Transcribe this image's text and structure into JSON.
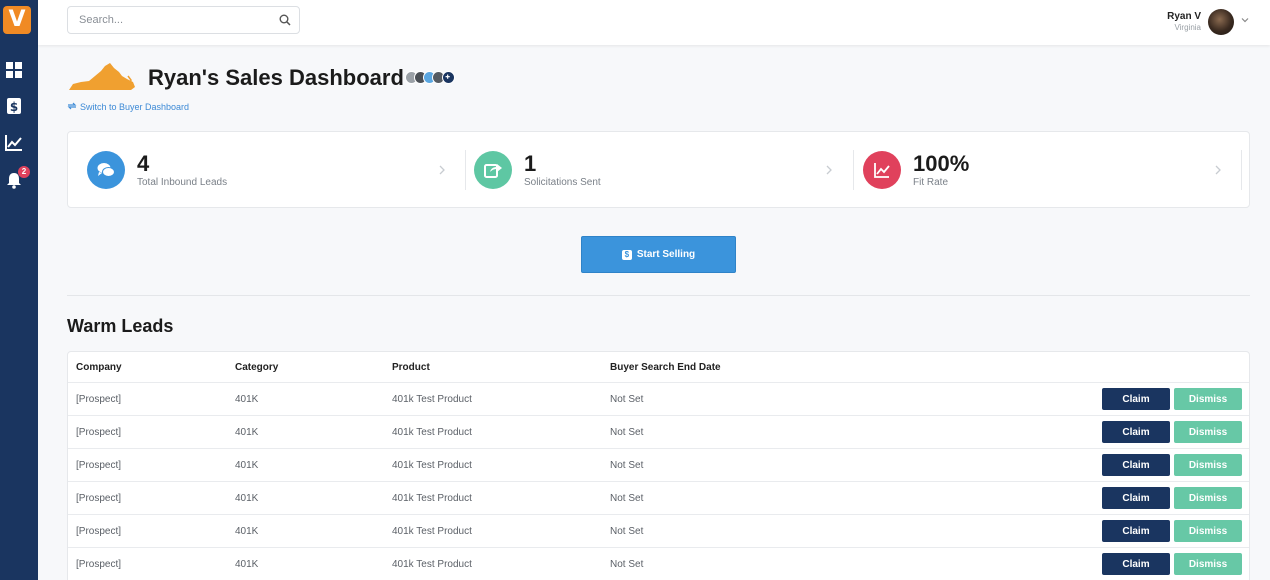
{
  "sidebar": {
    "logo_letter": "V",
    "items": [
      {
        "icon": "dashboard-icon"
      },
      {
        "icon": "dollar-icon"
      },
      {
        "icon": "chart-icon"
      },
      {
        "icon": "bell-icon",
        "badge": "2"
      }
    ]
  },
  "search": {
    "placeholder": "Search..."
  },
  "user": {
    "name": "Ryan V",
    "location": "Virginia"
  },
  "header": {
    "title": "Ryan's Sales Dashboard",
    "switch_link": "Switch to Buyer Dashboard"
  },
  "stats": [
    {
      "value": "4",
      "label": "Total Inbound Leads",
      "color": "#3b94dc",
      "icon": "chat-icon"
    },
    {
      "value": "1",
      "label": "Solicitations Sent",
      "color": "#5ec7a3",
      "icon": "share-icon"
    },
    {
      "value": "100%",
      "label": "Fit Rate",
      "color": "#e0415c",
      "icon": "chart-line-icon"
    }
  ],
  "start_button": {
    "label": "Start Selling"
  },
  "warm_leads": {
    "title": "Warm Leads",
    "columns": [
      "Company",
      "Category",
      "Product",
      "Buyer Search End Date"
    ],
    "claim_label": "Claim",
    "dismiss_label": "Dismiss",
    "rows": [
      {
        "company": "[Prospect]",
        "category": "401K",
        "product": "401k Test Product",
        "end_date": "Not Set"
      },
      {
        "company": "[Prospect]",
        "category": "401K",
        "product": "401k Test Product",
        "end_date": "Not Set"
      },
      {
        "company": "[Prospect]",
        "category": "401K",
        "product": "401k Test Product",
        "end_date": "Not Set"
      },
      {
        "company": "[Prospect]",
        "category": "401K",
        "product": "401k Test Product",
        "end_date": "Not Set"
      },
      {
        "company": "[Prospect]",
        "category": "401K",
        "product": "401k Test Product",
        "end_date": "Not Set"
      },
      {
        "company": "[Prospect]",
        "category": "401K",
        "product": "401k Test Product",
        "end_date": "Not Set"
      }
    ]
  },
  "colors": {
    "sidebar": "#1a3560",
    "accent": "#3b94dc",
    "orange": "#f08a24",
    "dismiss": "#67c8a6"
  }
}
